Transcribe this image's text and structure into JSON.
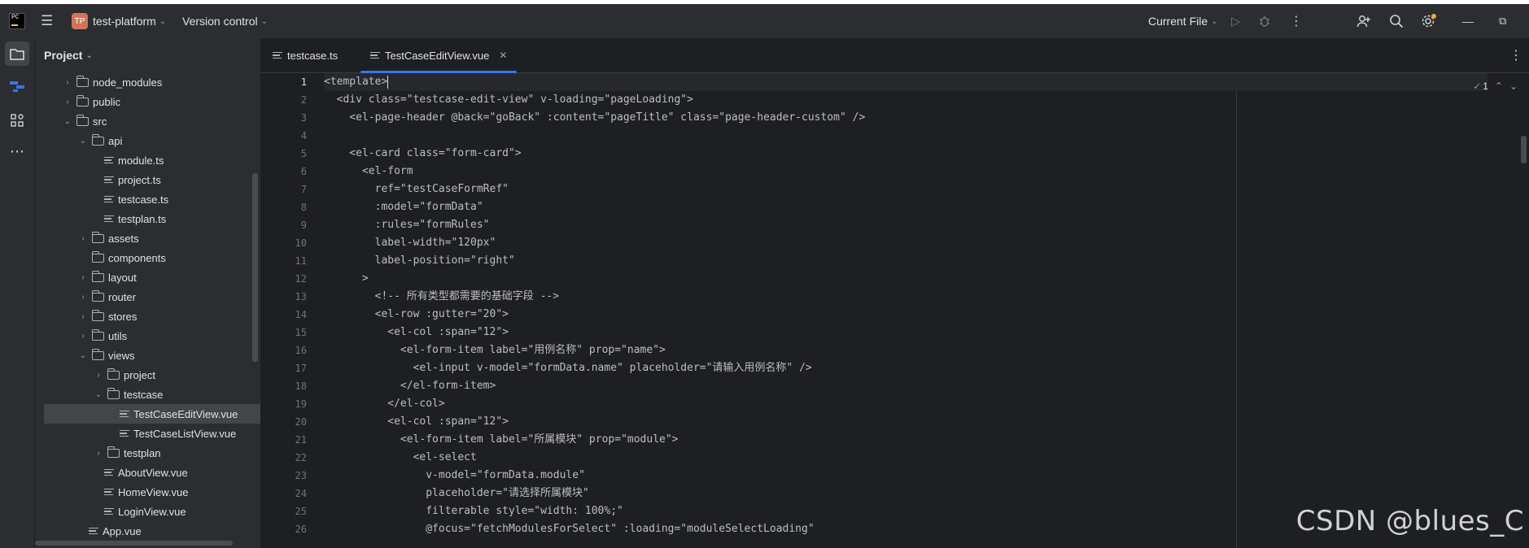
{
  "titlebar": {
    "project_badge": "TP",
    "project_name": "test-platform",
    "vcs_label": "Version control",
    "run_config": "Current File"
  },
  "project_panel": {
    "title": "Project",
    "tree": [
      {
        "label": "node_modules",
        "kind": "folder",
        "depth": 2,
        "arrow": "›"
      },
      {
        "label": "public",
        "kind": "folder",
        "depth": 2,
        "arrow": "›"
      },
      {
        "label": "src",
        "kind": "folder",
        "depth": 2,
        "arrow": "⌄"
      },
      {
        "label": "api",
        "kind": "folder",
        "depth": 3,
        "arrow": "⌄"
      },
      {
        "label": "module.ts",
        "kind": "file",
        "depth": 4,
        "arrow": ""
      },
      {
        "label": "project.ts",
        "kind": "file",
        "depth": 4,
        "arrow": ""
      },
      {
        "label": "testcase.ts",
        "kind": "file",
        "depth": 4,
        "arrow": ""
      },
      {
        "label": "testplan.ts",
        "kind": "file",
        "depth": 4,
        "arrow": ""
      },
      {
        "label": "assets",
        "kind": "folder",
        "depth": 3,
        "arrow": "›"
      },
      {
        "label": "components",
        "kind": "folder",
        "depth": 3,
        "arrow": ""
      },
      {
        "label": "layout",
        "kind": "folder",
        "depth": 3,
        "arrow": "›"
      },
      {
        "label": "router",
        "kind": "folder",
        "depth": 3,
        "arrow": "›"
      },
      {
        "label": "stores",
        "kind": "folder",
        "depth": 3,
        "arrow": "›"
      },
      {
        "label": "utils",
        "kind": "folder",
        "depth": 3,
        "arrow": "›"
      },
      {
        "label": "views",
        "kind": "folder",
        "depth": 3,
        "arrow": "⌄"
      },
      {
        "label": "project",
        "kind": "folder",
        "depth": 4,
        "arrow": "›"
      },
      {
        "label": "testcase",
        "kind": "folder",
        "depth": 4,
        "arrow": "⌄"
      },
      {
        "label": "TestCaseEditView.vue",
        "kind": "file",
        "depth": 5,
        "arrow": "",
        "selected": true
      },
      {
        "label": "TestCaseListView.vue",
        "kind": "file",
        "depth": 5,
        "arrow": ""
      },
      {
        "label": "testplan",
        "kind": "folder",
        "depth": 4,
        "arrow": "›"
      },
      {
        "label": "AboutView.vue",
        "kind": "file",
        "depth": 4,
        "arrow": ""
      },
      {
        "label": "HomeView.vue",
        "kind": "file",
        "depth": 4,
        "arrow": ""
      },
      {
        "label": "LoginView.vue",
        "kind": "file",
        "depth": 4,
        "arrow": ""
      },
      {
        "label": "App.vue",
        "kind": "file",
        "depth": 3,
        "arrow": ""
      }
    ]
  },
  "editor": {
    "tabs": [
      {
        "label": "testcase.ts",
        "active": false
      },
      {
        "label": "TestCaseEditView.vue",
        "active": true
      }
    ],
    "inspection_count": "1",
    "lines": [
      {
        "n": "1",
        "text": "<template>"
      },
      {
        "n": "2",
        "text": "  <div class=\"testcase-edit-view\" v-loading=\"pageLoading\">"
      },
      {
        "n": "3",
        "text": "    <el-page-header @back=\"goBack\" :content=\"pageTitle\" class=\"page-header-custom\" />"
      },
      {
        "n": "4",
        "text": ""
      },
      {
        "n": "5",
        "text": "    <el-card class=\"form-card\">"
      },
      {
        "n": "6",
        "text": "      <el-form"
      },
      {
        "n": "7",
        "text": "        ref=\"testCaseFormRef\""
      },
      {
        "n": "8",
        "text": "        :model=\"formData\""
      },
      {
        "n": "9",
        "text": "        :rules=\"formRules\""
      },
      {
        "n": "10",
        "text": "        label-width=\"120px\""
      },
      {
        "n": "11",
        "text": "        label-position=\"right\""
      },
      {
        "n": "12",
        "text": "      >"
      },
      {
        "n": "13",
        "text": "        <!-- 所有类型都需要的基础字段 -->"
      },
      {
        "n": "14",
        "text": "        <el-row :gutter=\"20\">"
      },
      {
        "n": "15",
        "text": "          <el-col :span=\"12\">"
      },
      {
        "n": "16",
        "text": "            <el-form-item label=\"用例名称\" prop=\"name\">"
      },
      {
        "n": "17",
        "text": "              <el-input v-model=\"formData.name\" placeholder=\"请输入用例名称\" />"
      },
      {
        "n": "18",
        "text": "            </el-form-item>"
      },
      {
        "n": "19",
        "text": "          </el-col>"
      },
      {
        "n": "20",
        "text": "          <el-col :span=\"12\">"
      },
      {
        "n": "21",
        "text": "            <el-form-item label=\"所属模块\" prop=\"module\">"
      },
      {
        "n": "22",
        "text": "              <el-select"
      },
      {
        "n": "23",
        "text": "                v-model=\"formData.module\""
      },
      {
        "n": "24",
        "text": "                placeholder=\"请选择所属模块\""
      },
      {
        "n": "25",
        "text": "                filterable style=\"width: 100%;\""
      },
      {
        "n": "26",
        "text": "                @focus=\"fetchModulesForSelect\" :loading=\"moduleSelectLoading\""
      }
    ]
  },
  "watermark": "CSDN @blues_C",
  "colors": {
    "accent": "#3574f0",
    "bg_editor": "#1e1f22",
    "bg_panel": "#2b2d30",
    "text": "#dfe1e5",
    "check_green": "#5fb865",
    "notify_dot": "#f0a732"
  }
}
